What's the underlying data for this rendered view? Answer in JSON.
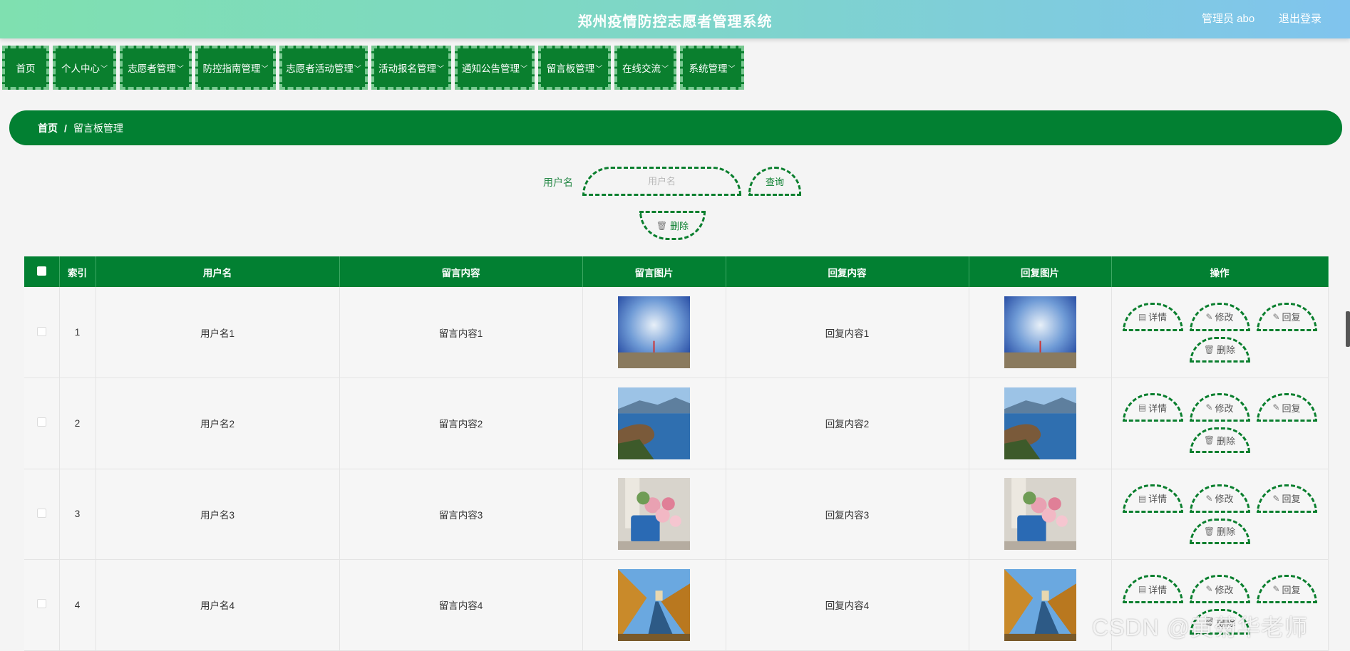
{
  "header": {
    "title": "郑州疫情防控志愿者管理系统",
    "admin": "管理员 abo",
    "logout": "退出登录"
  },
  "nav": [
    {
      "label": "首页",
      "chevron": false
    },
    {
      "label": "个人中心",
      "chevron": true
    },
    {
      "label": "志愿者管理",
      "chevron": true
    },
    {
      "label": "防控指南管理",
      "chevron": true
    },
    {
      "label": "志愿者活动管理",
      "chevron": true
    },
    {
      "label": "活动报名管理",
      "chevron": true
    },
    {
      "label": "通知公告管理",
      "chevron": true
    },
    {
      "label": "留言板管理",
      "chevron": true
    },
    {
      "label": "在线交流",
      "chevron": true
    },
    {
      "label": "系统管理",
      "chevron": true
    }
  ],
  "breadcrumb": {
    "home": "首页",
    "sep": "/",
    "current": "留言板管理"
  },
  "search": {
    "label": "用户名",
    "placeholder": "用户名",
    "query": "查询",
    "delete": "删除"
  },
  "table": {
    "headers": [
      "索引",
      "用户名",
      "留言内容",
      "留言图片",
      "回复内容",
      "回复图片",
      "操作"
    ],
    "rows": [
      {
        "index": "1",
        "username": "用户名1",
        "content": "留言内容1",
        "image": "sky-photo",
        "reply": "回复内容1",
        "reply_image": "sky-photo"
      },
      {
        "index": "2",
        "username": "用户名2",
        "content": "留言内容2",
        "image": "lake-photo",
        "reply": "回复内容2",
        "reply_image": "lake-photo"
      },
      {
        "index": "3",
        "username": "用户名3",
        "content": "留言内容3",
        "image": "flower-photo",
        "reply": "回复内容3",
        "reply_image": "flower-photo"
      },
      {
        "index": "4",
        "username": "用户名4",
        "content": "留言内容4",
        "image": "path-photo",
        "reply": "回复内容4",
        "reply_image": "path-photo"
      }
    ],
    "actions": {
      "detail": "详情",
      "edit": "修改",
      "reply": "回复",
      "delete": "删除"
    }
  },
  "watermark": "CSDN @黄菊华老师",
  "colors": {
    "primary": "#028032",
    "header_start": "#7fe0b0",
    "header_end": "#80c4ee"
  }
}
